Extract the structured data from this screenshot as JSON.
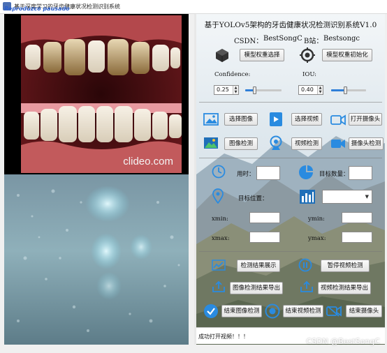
{
  "window": {
    "title": "基于深度学习的牙齿健康状况检测识别系统",
    "overlay_text": "Reproduzco pausado"
  },
  "video": {
    "watermark": "clideo.com"
  },
  "header": {
    "title": "基于YOLOv5架构的牙齿健康状况检测识别系统V1.0",
    "csdn_label": "CSDN：",
    "csdn_value": "BestSongC",
    "bili_label": "B站：",
    "bili_value": "Bestsongc"
  },
  "model": {
    "select_label": "模型权重选择",
    "init_label": "模型权重初始化"
  },
  "params": {
    "confidence_label": "Confidence:",
    "confidence_value": "0.25",
    "confidence_fraction": 0.25,
    "iou_label": "IOU:",
    "iou_value": "0.40",
    "iou_fraction": 0.4
  },
  "media": {
    "select_image": "选择图像",
    "select_video": "选择视频",
    "open_camera": "打开摄像头",
    "image_detect": "图像检测",
    "video_detect": "视频检测",
    "camera_detect": "摄像头检测"
  },
  "results": {
    "time_label": "用时：",
    "time_value": "",
    "count_label": "目标数量：",
    "count_value": "",
    "position_label": "目标位置：",
    "target_select_value": "",
    "xmin_label": "xmin:",
    "xmin_value": "",
    "ymin_label": "ymin:",
    "ymin_value": "",
    "xmax_label": "xmax:",
    "xmax_value": "",
    "ymax_label": "ymax:",
    "ymax_value": ""
  },
  "actions": {
    "show_results": "检测结果展示",
    "pause_video": "暂停视频检测",
    "export_image": "图像检测结果导出",
    "export_video": "视频检测结果导出",
    "end_image": "结束图像检测",
    "end_video": "结束视频检测",
    "end_camera": "结束摄像头"
  },
  "status": {
    "message": "成功打开视频！！！"
  },
  "page_watermark": "CSDN @BestSongC",
  "colors": {
    "accent": "#2f7fd8",
    "icon_blue": "#2a8be0",
    "icon_dark": "#333333"
  }
}
